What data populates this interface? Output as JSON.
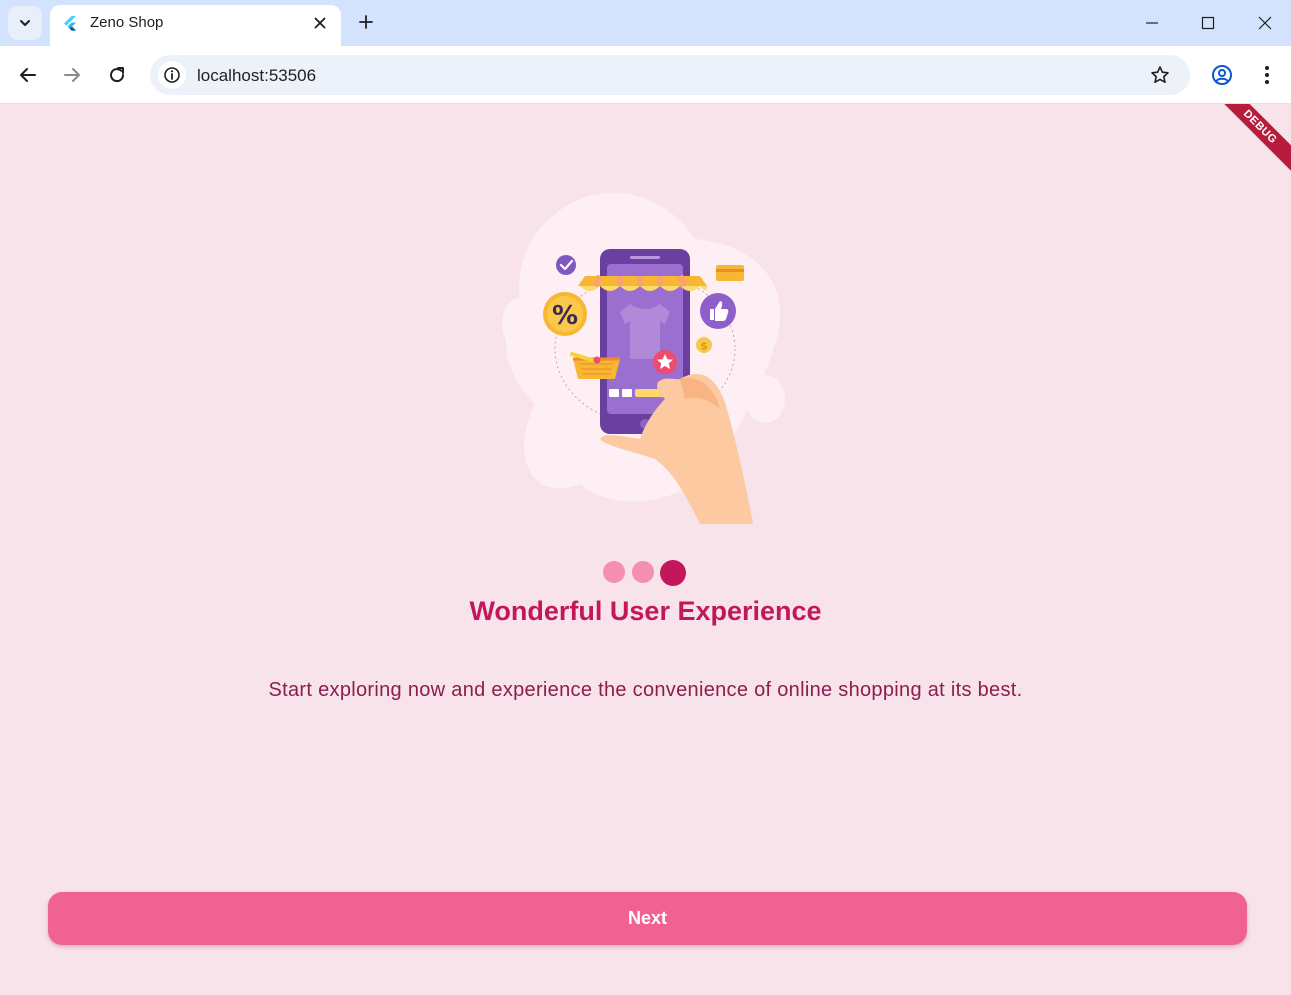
{
  "browser": {
    "tab_title": "Zeno Shop",
    "url": "localhost:53506",
    "icons": {
      "tab_search": "chevron-down-icon",
      "favicon": "flutter-icon",
      "close_tab": "close-icon",
      "new_tab": "plus-icon",
      "minimize": "minimize-icon",
      "maximize": "maximize-icon",
      "close_window": "close-icon",
      "back": "back-arrow-icon",
      "forward": "forward-arrow-icon",
      "reload": "reload-icon",
      "site_info": "info-icon",
      "bookmark": "star-icon",
      "profile": "profile-icon",
      "menu": "kebab-menu-icon"
    }
  },
  "app": {
    "debug_label": "DEBUG",
    "pager": {
      "total_pages": 3,
      "current_page": 3
    },
    "headline": "Wonderful User Experience",
    "subtitle": "Start exploring now and experience the convenience of online shopping at its best.",
    "next_label": "Next",
    "colors": {
      "background": "#f9e3ea",
      "primary": "#c2185b",
      "button": "#f06292",
      "dot_inactive": "#f48fb1",
      "dot_active": "#c2185b"
    }
  }
}
